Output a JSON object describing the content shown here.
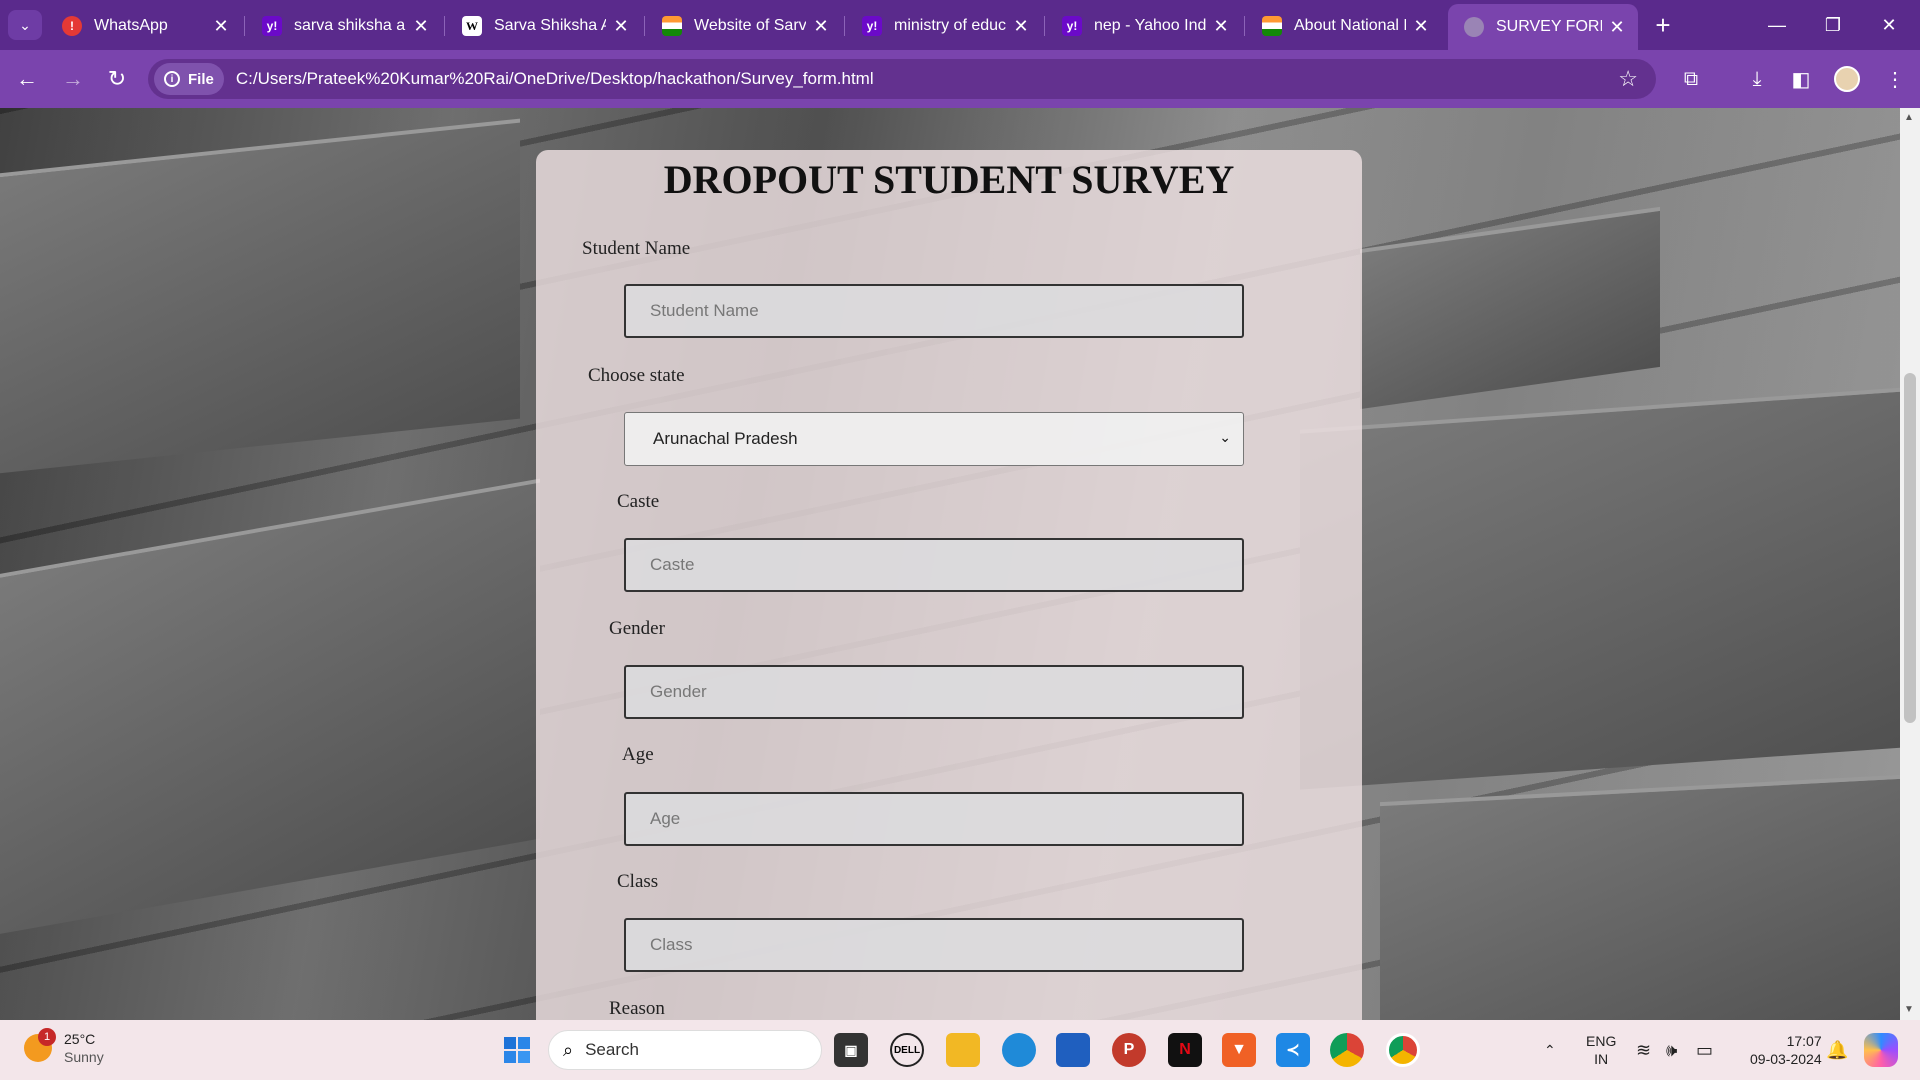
{
  "browser": {
    "tabs": [
      {
        "title": "WhatsApp",
        "icon": "whatsapp-icon"
      },
      {
        "title": "sarva shiksha abh",
        "icon": "yahoo-icon"
      },
      {
        "title": "Sarva Shiksha Ab",
        "icon": "wikipedia-icon"
      },
      {
        "title": "Website of Sarva",
        "icon": "india-flag-icon"
      },
      {
        "title": "ministry of educa",
        "icon": "yahoo-icon"
      },
      {
        "title": "nep - Yahoo Indi",
        "icon": "yahoo-icon"
      },
      {
        "title": "About National E",
        "icon": "india-flag-icon"
      },
      {
        "title": "SURVEY FORM",
        "icon": "globe-icon"
      }
    ],
    "active_tab_index": 7,
    "address": {
      "chip_label": "File",
      "url": "C:/Users/Prateek%20Kumar%20Rai/OneDrive/Desktop/hackathon/Survey_form.html"
    },
    "colors": {
      "frame": "#5a2a8c",
      "toolbar": "#7a44ad"
    }
  },
  "form": {
    "heading": "DROPOUT STUDENT SURVEY",
    "fields": {
      "student_name": {
        "label": "Student Name",
        "placeholder": "Student Name"
      },
      "state": {
        "label": "Choose state",
        "selected": "Arunachal Pradesh"
      },
      "caste": {
        "label": "Caste",
        "placeholder": "Caste"
      },
      "gender": {
        "label": "Gender",
        "placeholder": "Gender"
      },
      "age": {
        "label": "Age",
        "placeholder": "Age"
      },
      "class": {
        "label": "Class",
        "placeholder": "Class"
      },
      "reason": {
        "label": "Reason"
      }
    }
  },
  "taskbar": {
    "weather": {
      "temp": "25°C",
      "condition": "Sunny",
      "badge": "1"
    },
    "search_label": "Search",
    "language": {
      "line1": "ENG",
      "line2": "IN"
    },
    "clock": {
      "time": "17:07",
      "date": "09-03-2024"
    }
  }
}
